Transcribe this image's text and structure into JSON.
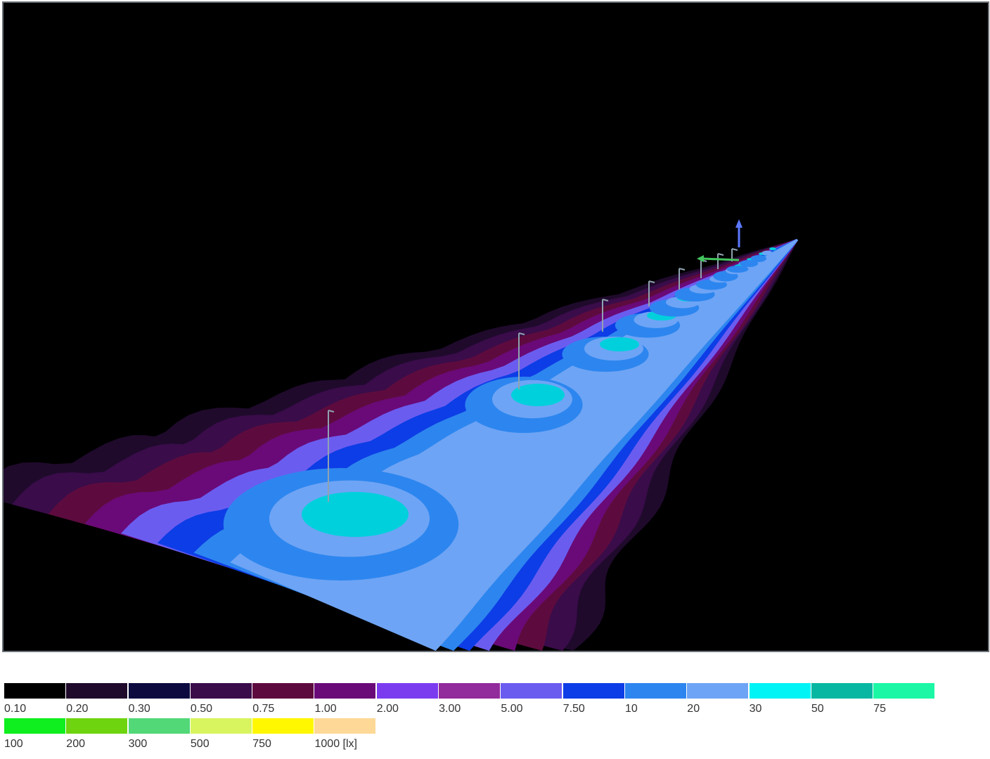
{
  "legend": {
    "unit_suffix": "[lx]",
    "rows": [
      [
        {
          "value": "0.10",
          "color": "#000000"
        },
        {
          "value": "0.20",
          "color": "#1f0a2c"
        },
        {
          "value": "0.30",
          "color": "#0c0a3e"
        },
        {
          "value": "0.50",
          "color": "#3a0c4a"
        },
        {
          "value": "0.75",
          "color": "#5d0b3e"
        },
        {
          "value": "1.00",
          "color": "#6a0a78"
        },
        {
          "value": "2.00",
          "color": "#7b3cf0"
        },
        {
          "value": "3.00",
          "color": "#922b9c"
        },
        {
          "value": "5.00",
          "color": "#6b5cf0"
        },
        {
          "value": "7.50",
          "color": "#0d3de6"
        },
        {
          "value": "10",
          "color": "#2d86ef"
        },
        {
          "value": "20",
          "color": "#6ea4f5"
        },
        {
          "value": "30",
          "color": "#00f3f5"
        },
        {
          "value": "50",
          "color": "#07b7a1"
        },
        {
          "value": "75",
          "color": "#1bf7a5"
        }
      ],
      [
        {
          "value": "100",
          "color": "#0fee1f"
        },
        {
          "value": "200",
          "color": "#6ed40f"
        },
        {
          "value": "300",
          "color": "#53d878"
        },
        {
          "value": "500",
          "color": "#d8f560"
        },
        {
          "value": "750",
          "color": "#fff700"
        },
        {
          "value": "1000",
          "color": "#fdd897"
        }
      ]
    ]
  },
  "scene": {
    "background": "#000000",
    "bands": [
      "#1f0a2c",
      "#3a0c4a",
      "#5d0b3e",
      "#6a0a78",
      "#6b5cf0",
      "#0d3de6",
      "#2d86ef",
      "#6ea4f5"
    ],
    "pool_color": "#00d0dc",
    "pole_color": "#8fa3b0",
    "axis_up_color": "#5b78ff",
    "axis_side_color": "#43c55e"
  }
}
